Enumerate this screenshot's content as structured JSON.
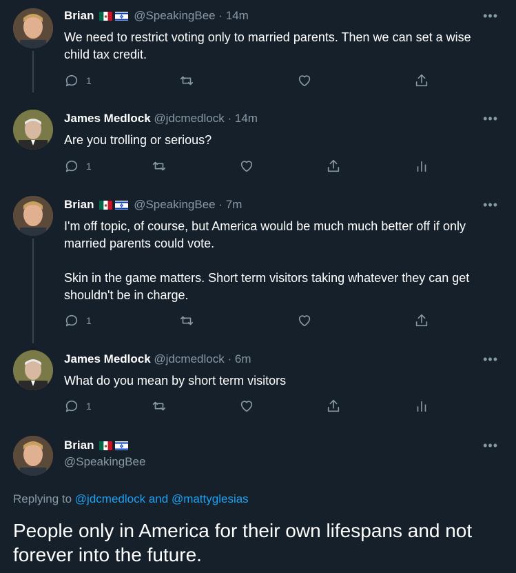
{
  "tweets": [
    {
      "name": "Brian",
      "handle": "@SpeakingBee",
      "time": "14m",
      "text": [
        "We need to restrict voting only to married parents. Then we can set a wise child tax credit."
      ],
      "reply_count": "1"
    },
    {
      "name": "James Medlock",
      "handle": "@jdcmedlock",
      "time": "14m",
      "text": [
        "Are you trolling or serious?"
      ],
      "reply_count": "1"
    },
    {
      "name": "Brian",
      "handle": "@SpeakingBee",
      "time": "7m",
      "text": [
        "I'm off topic, of course, but America would be much much better off if only married parents could vote.",
        "Skin in the game matters. Short term visitors taking whatever they can get shouldn't be in charge."
      ],
      "reply_count": "1"
    },
    {
      "name": "James Medlock",
      "handle": "@jdcmedlock",
      "time": "6m",
      "text": [
        "What do you mean by short term visitors"
      ],
      "reply_count": "1"
    }
  ],
  "main_tweet": {
    "name": "Brian",
    "handle": "@SpeakingBee",
    "replying_prefix": "Replying to",
    "mention1": "@jdcmedlock",
    "and": "and",
    "mention2": "@mattyglesias",
    "text": "People only in America for their own lifespans and not forever into the future."
  },
  "separator": "·",
  "more_glyph": "•••",
  "icons": [
    "reply-icon",
    "retweet-icon",
    "like-icon",
    "share-icon",
    "analytics-icon",
    "more-icon",
    "mexico-flag-icon",
    "israel-flag-icon"
  ],
  "colors": {
    "background": "#15202b",
    "muted": "#8899a6",
    "link": "#1da1f2",
    "thread_line": "#38444d"
  }
}
